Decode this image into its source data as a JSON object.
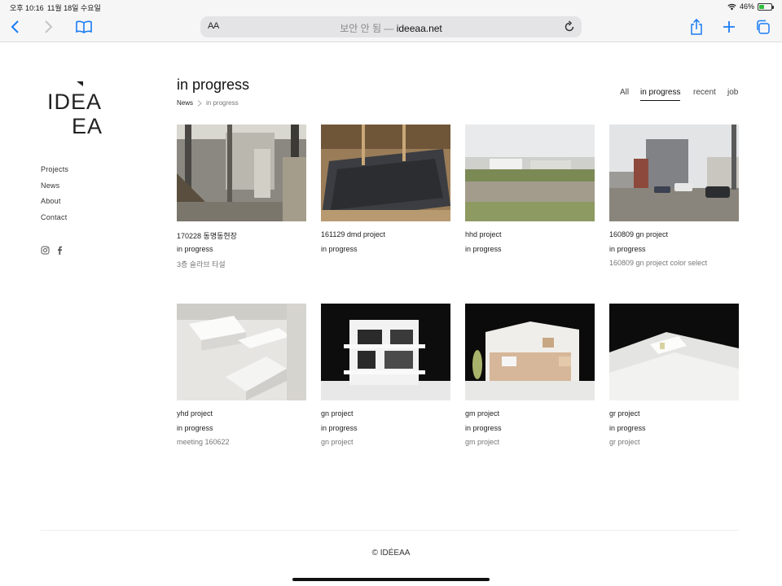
{
  "status": {
    "time": "오후 10:16",
    "date": "11월 18일 수요일",
    "battery": "46%",
    "battery_level": 0.46
  },
  "browser": {
    "reader_label": "AA",
    "security": "보안 안 됨 —",
    "domain": "ideeaa.net"
  },
  "site": {
    "logo_line1": "IDEA",
    "logo_line2": "EA",
    "nav": [
      "Projects",
      "News",
      "About",
      "Contact"
    ],
    "social_icons": [
      "instagram-icon",
      "facebook-icon"
    ]
  },
  "main": {
    "title": "in progress",
    "breadcrumb": {
      "home": "News",
      "current": "in progress"
    },
    "filters": [
      "All",
      "in progress",
      "recent",
      "job"
    ],
    "active_filter": "in progress"
  },
  "cards": [
    {
      "title": "170228 동명동현장",
      "status": "in progress",
      "desc": "3층 슬라브 타설"
    },
    {
      "title": "161129 dmd project",
      "status": "in progress",
      "desc": ""
    },
    {
      "title": "hhd project",
      "status": "in progress",
      "desc": ""
    },
    {
      "title": "160809 gn project",
      "status": "in progress",
      "desc": "160809 gn project color select"
    },
    {
      "title": "yhd project",
      "status": "in progress",
      "desc": "meeting 160622"
    },
    {
      "title": "gn project",
      "status": "in progress",
      "desc": "gn project"
    },
    {
      "title": "gm project",
      "status": "in progress",
      "desc": "gm project"
    },
    {
      "title": "gr project",
      "status": "in progress",
      "desc": "gr project"
    }
  ],
  "footer": {
    "copyright": "© IDÉEAA"
  }
}
